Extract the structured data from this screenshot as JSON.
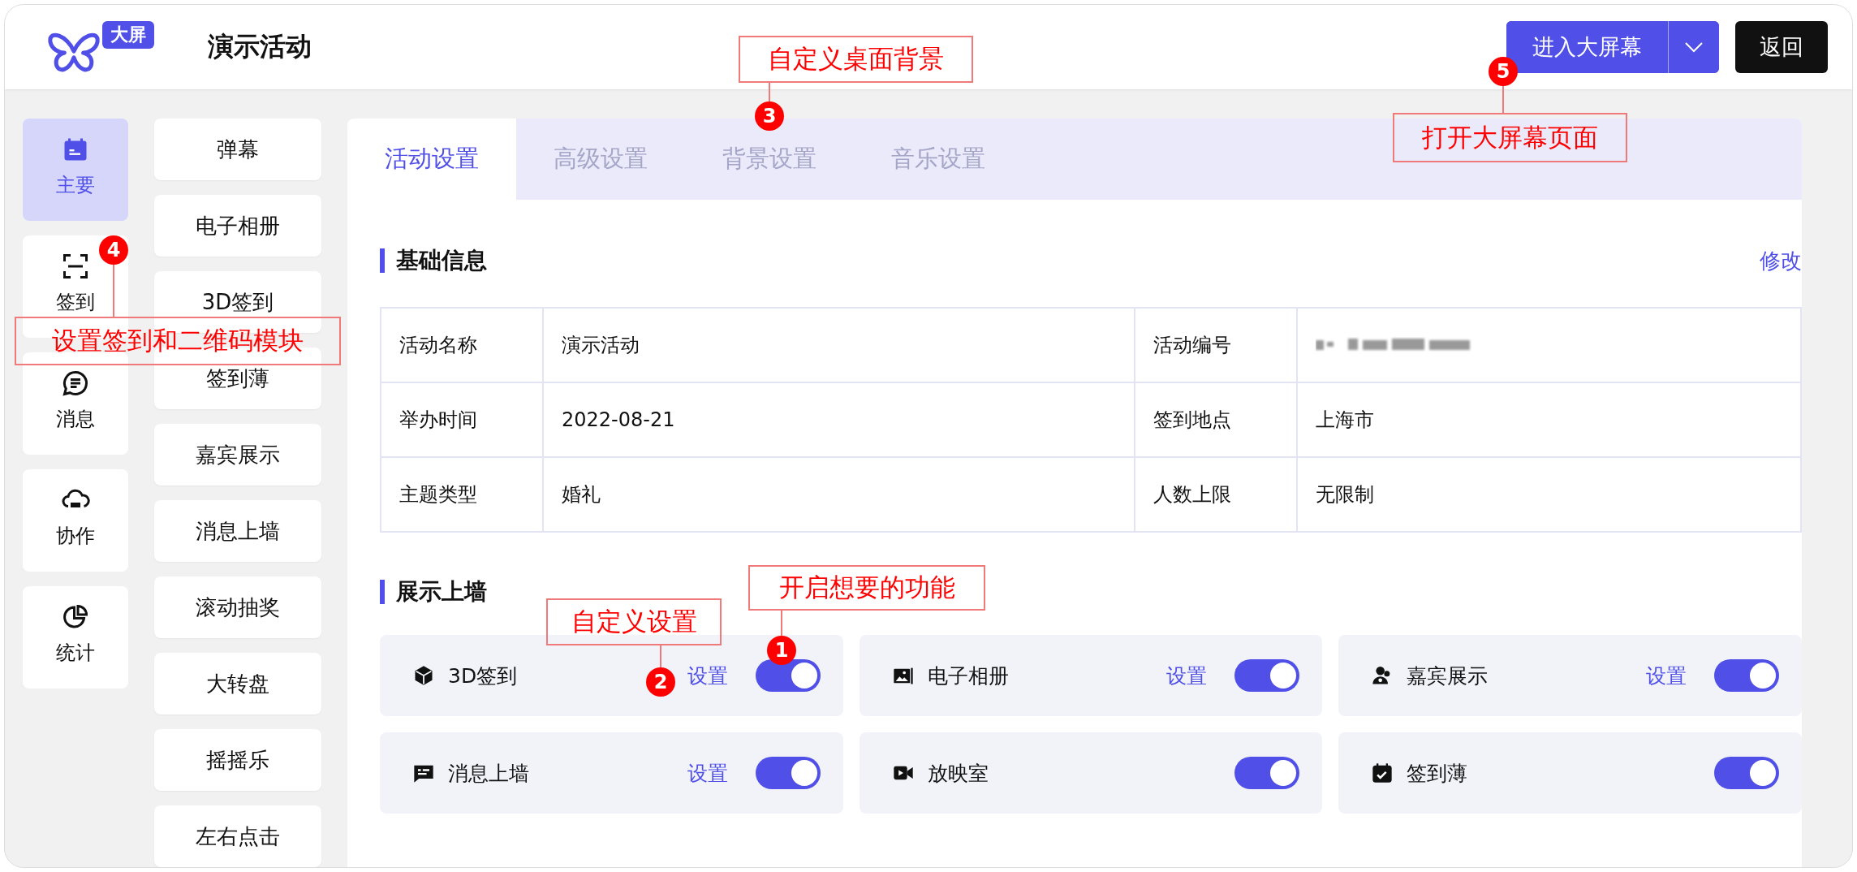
{
  "header": {
    "logo_badge": "大屏",
    "title": "演示活动",
    "primary_button": "进入大屏幕",
    "back_button": "返回"
  },
  "nav": [
    {
      "label": "主要",
      "selected": true
    },
    {
      "label": "签到",
      "selected": false
    },
    {
      "label": "消息",
      "selected": false
    },
    {
      "label": "协作",
      "selected": false
    },
    {
      "label": "统计",
      "selected": false
    }
  ],
  "modules": [
    "弹幕",
    "电子相册",
    "3D签到",
    "签到薄",
    "嘉宾展示",
    "消息上墙",
    "滚动抽奖",
    "大转盘",
    "摇摇乐",
    "左右点击"
  ],
  "tabs": [
    {
      "label": "活动设置",
      "selected": true
    },
    {
      "label": "高级设置",
      "selected": false
    },
    {
      "label": "背景设置",
      "selected": false
    },
    {
      "label": "音乐设置",
      "selected": false
    }
  ],
  "basic_info": {
    "title": "基础信息",
    "edit_link": "修改",
    "fields": [
      {
        "label": "活动名称",
        "value": "演示活动"
      },
      {
        "label": "活动编号",
        "redacted": true
      },
      {
        "label": "举办时间",
        "value": "2022-08-21"
      },
      {
        "label": "签到地点",
        "value": "上海市"
      },
      {
        "label": "主题类型",
        "value": "婚礼"
      },
      {
        "label": "人数上限",
        "value": "无限制"
      }
    ]
  },
  "display": {
    "title": "展示上墙",
    "features": [
      {
        "label": "3D签到",
        "settings": "设置",
        "on": true
      },
      {
        "label": "电子相册",
        "settings": "设置",
        "on": true
      },
      {
        "label": "嘉宾展示",
        "settings": "设置",
        "on": true
      },
      {
        "label": "消息上墙",
        "settings": "设置",
        "on": true
      },
      {
        "label": "放映室",
        "on": true
      },
      {
        "label": "签到薄",
        "on": true
      }
    ]
  },
  "annotations": [
    {
      "number": "1",
      "text": "开启想要的功能"
    },
    {
      "number": "2",
      "text": "自定义设置"
    },
    {
      "number": "3",
      "text": "自定义桌面背景"
    },
    {
      "number": "4",
      "text": "设置签到和二维码模块"
    },
    {
      "number": "5",
      "text": "打开大屏幕页面"
    }
  ]
}
